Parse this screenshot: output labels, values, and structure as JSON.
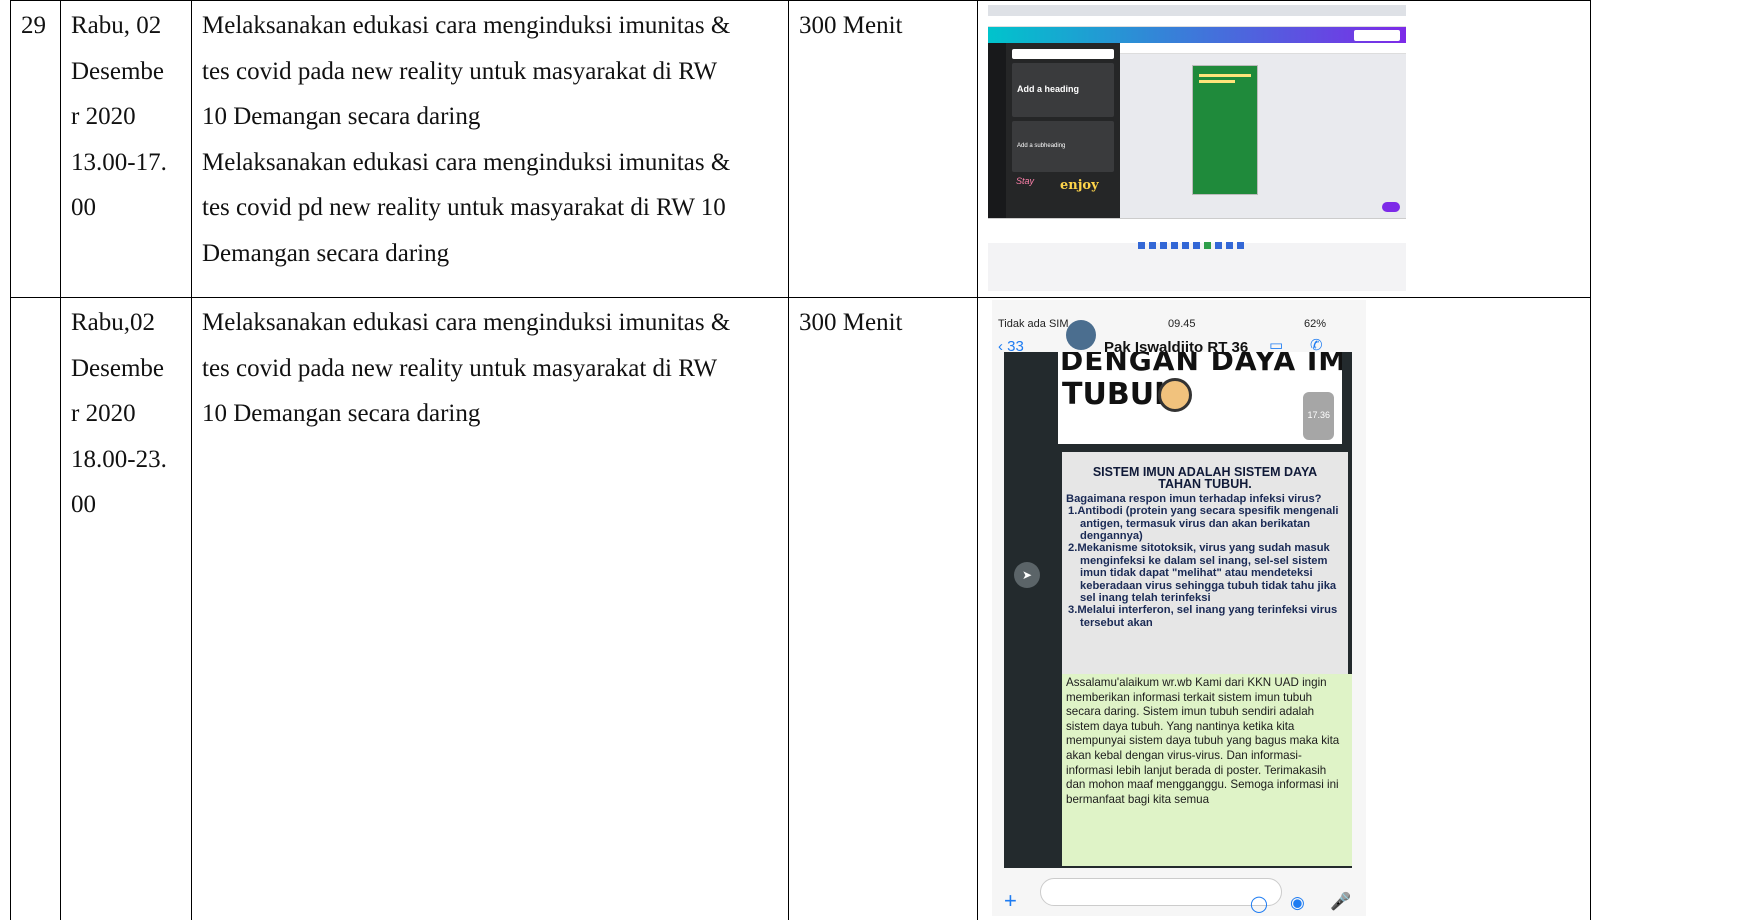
{
  "rows": [
    {
      "no": "29",
      "date_lines": [
        "Rabu, 02",
        "Desembe",
        "r 2020",
        "13.00-17.",
        "00"
      ],
      "activity_lines": [
        "Melaksanakan edukasi cara menginduksi imunitas &",
        "tes covid  pada new reality untuk masyarakat di RW",
        "10 Demangan secara daring",
        "Melaksanakan edukasi cara menginduksi imunitas &",
        "tes covid pd new reality untuk masyarakat di RW 10",
        "Demangan secara daring"
      ],
      "duration": "300 Menit",
      "screenshot": {
        "panel_heading": "Add a heading",
        "panel_subheading": "Add a subheading",
        "sticker_text": "enjoy",
        "sticker_script": "Stay"
      }
    },
    {
      "no": "",
      "date_lines": [
        "Rabu,02",
        "Desembe",
        "r 2020",
        "18.00-23.",
        "00"
      ],
      "activity_lines": [
        "Melaksanakan edukasi cara menginduksi imunitas &",
        "tes covid  pada new reality untuk masyarakat di RW",
        "10 Demangan secara daring"
      ],
      "duration": "300 Menit",
      "screenshot": {
        "status": {
          "carrier": "Tidak ada SIM",
          "time": "09.45",
          "battery": "62%"
        },
        "header": {
          "back_count": "33",
          "contact_name": "Pak Iswaldjito RT 36"
        },
        "poster_line1": "DENGAN DAYA IMUN",
        "poster_line2": "TUBUH",
        "poster_time": "17.36",
        "info_heading_1": "SISTEM IMUN ADALAH SISTEM DAYA",
        "info_heading_2": "TAHAN TUBUH.",
        "info_question": "Bagaimana respon imun terhadap infeksi virus?",
        "info_item_1": "1.Antibodi (protein yang secara spesifik mengenali antigen, termasuk virus dan akan berikatan dengannya)",
        "info_item_2": "2.Mekanisme sitotoksik, virus yang sudah masuk menginfeksi ke dalam sel inang, sel-sel sistem imun tidak dapat \"melihat\" atau mendeteksi keberadaan virus sehingga tubuh tidak tahu jika sel inang telah terinfeksi",
        "info_item_3": "3.Melalui interferon, sel inang yang terinfeksi virus tersebut akan",
        "message": "Assalamu'alaikum wr.wb  Kami dari KKN UAD ingin memberikan informasi terkait sistem imun tubuh secara daring. Sistem imun tubuh sendiri adalah sistem daya tubuh. Yang nantinya ketika kita mempunyai sistem daya tubuh yang bagus maka kita akan kebal dengan virus-virus. Dan informasi-informasi lebih lanjut berada di poster.  Terimakasih dan mohon maaf mengganggu.  Semoga informasi ini bermanfaat bagi kita semua"
      }
    }
  ]
}
